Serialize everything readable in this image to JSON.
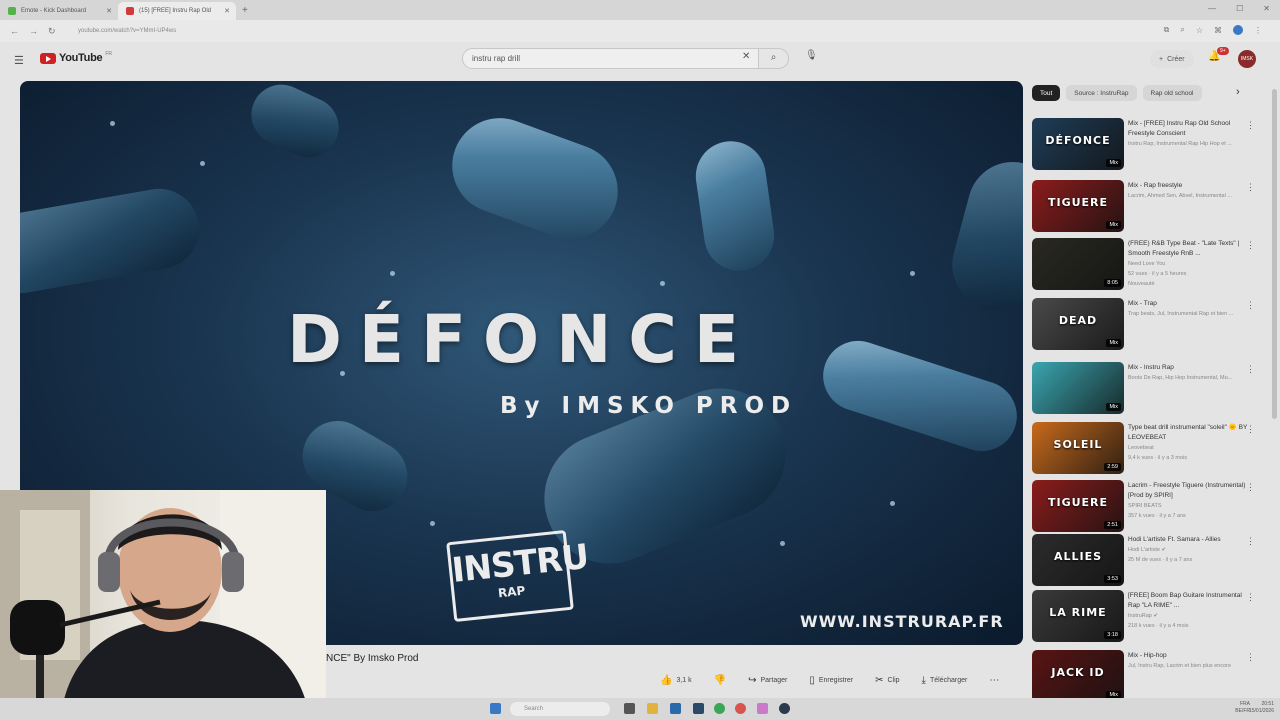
{
  "browser": {
    "tabs": [
      {
        "title": "Emote - Kick Dashboard",
        "favicon_color": "#53b34a",
        "active": false
      },
      {
        "title": "(15) [FREE] Instru Rap Old",
        "favicon_color": "#d33a3a",
        "active": true
      }
    ],
    "url": "youtube.com/watch?v=YMmI-UP4ws"
  },
  "header": {
    "logo_text": "YouTube",
    "logo_country": "FR",
    "search_value": "instru rap drill",
    "create_label": "Créer",
    "notifications_count": "9+",
    "avatar_text": "IMSK"
  },
  "video": {
    "thumb_title": "DÉFONCE",
    "thumb_by": "By IMSKO PROD",
    "thumb_logo_top": "INSTRU",
    "thumb_logo_bottom": "RAP",
    "thumb_site": "WWW.INSTRURAP.FR",
    "title_fragment": "NCE\" By Imsko Prod",
    "likes": "3,1 k",
    "share_label": "Partager",
    "save_label": "Enregistrer",
    "clip_label": "Clip",
    "download_label": "Télécharger"
  },
  "chips": [
    "Tout",
    "Source : InstruRap",
    "Rap old school"
  ],
  "recommendations": [
    {
      "title": "Mix - [FREE] Instru Rap Old School Freestyle Conscient",
      "channel": "Instru Rap, Instrumental Rap Hip Hop et ...",
      "meta": "",
      "duration": "Mix",
      "thumb_text": "DÉFONCE",
      "thumb_color": "#1f3d58"
    },
    {
      "title": "Mix - Rap freestyle",
      "channel": "Lacrim, Ahmed Sen, Abvel, Instrumental ...",
      "meta": "",
      "duration": "Mix",
      "thumb_text": "TIGUERE",
      "thumb_color": "#8c1c1c"
    },
    {
      "title": "(FREE) R&B Type Beat - \"Late Texts\" | Smooth Freestyle RnB ...",
      "channel": "Need Love You",
      "meta": "52 vues · il y a 5 heures",
      "badge": "Nouveauté",
      "duration": "8:05",
      "thumb_text": "",
      "thumb_color": "#2a2a22"
    },
    {
      "title": "Mix - Trap",
      "channel": "Trap beats, Jul, Instrumental Rap et bien ...",
      "meta": "",
      "duration": "Mix",
      "thumb_text": "DEAD",
      "thumb_color": "#4a4a4a"
    },
    {
      "title": "Mix - Instru Rap",
      "channel": "Boots De Rap, Hip Hop Instrumental, Mu...",
      "meta": "",
      "duration": "Mix",
      "thumb_text": "",
      "thumb_color": "#3aa6b0"
    },
    {
      "title": "Type beat drill instrumental \"soleil\" 🌞 BY LEOVEBEAT",
      "channel": "Leovebeat",
      "meta": "9,4 k vues · il y a 3 mois",
      "duration": "2:59",
      "thumb_text": "SOLEIL",
      "thumb_color": "#c86a1c"
    },
    {
      "title": "Lacrim - Freestyle Tiguere (Instrumental) [Prod by SPIRI]",
      "channel": "SPIRI BEATS",
      "meta": "357 k vues · il y a 7 ans",
      "duration": "2:51",
      "thumb_text": "TIGUERE",
      "thumb_color": "#8c1c1c"
    },
    {
      "title": "Hodi L'artiste Ft. Samara - Allies",
      "channel": "Hodi L'artiste ✔",
      "meta": "25 M de vues · il y a 7 ans",
      "duration": "3:53",
      "thumb_text": "ALLIES",
      "thumb_color": "#2c2c2c"
    },
    {
      "title": "[FREE] Boom Bap Guitare Instrumental Rap \"LA RIME\" ...",
      "channel": "InstruRap ✔",
      "meta": "218 k vues · il y a 4 mois",
      "duration": "3:18",
      "thumb_text": "LA RIME",
      "thumb_color": "#3a3a3a"
    },
    {
      "title": "Mix - Hip-hop",
      "channel": "Jul, Instru Rap, Lacrim et bien plus encore",
      "meta": "",
      "duration": "Mix",
      "thumb_text": "JACK ID",
      "thumb_color": "#5a1414"
    }
  ],
  "taskbar": {
    "search_placeholder": "Search",
    "lang": "FRA",
    "lang_sub": "BE/FR",
    "time": "20:51",
    "date": "15/01/2026"
  }
}
